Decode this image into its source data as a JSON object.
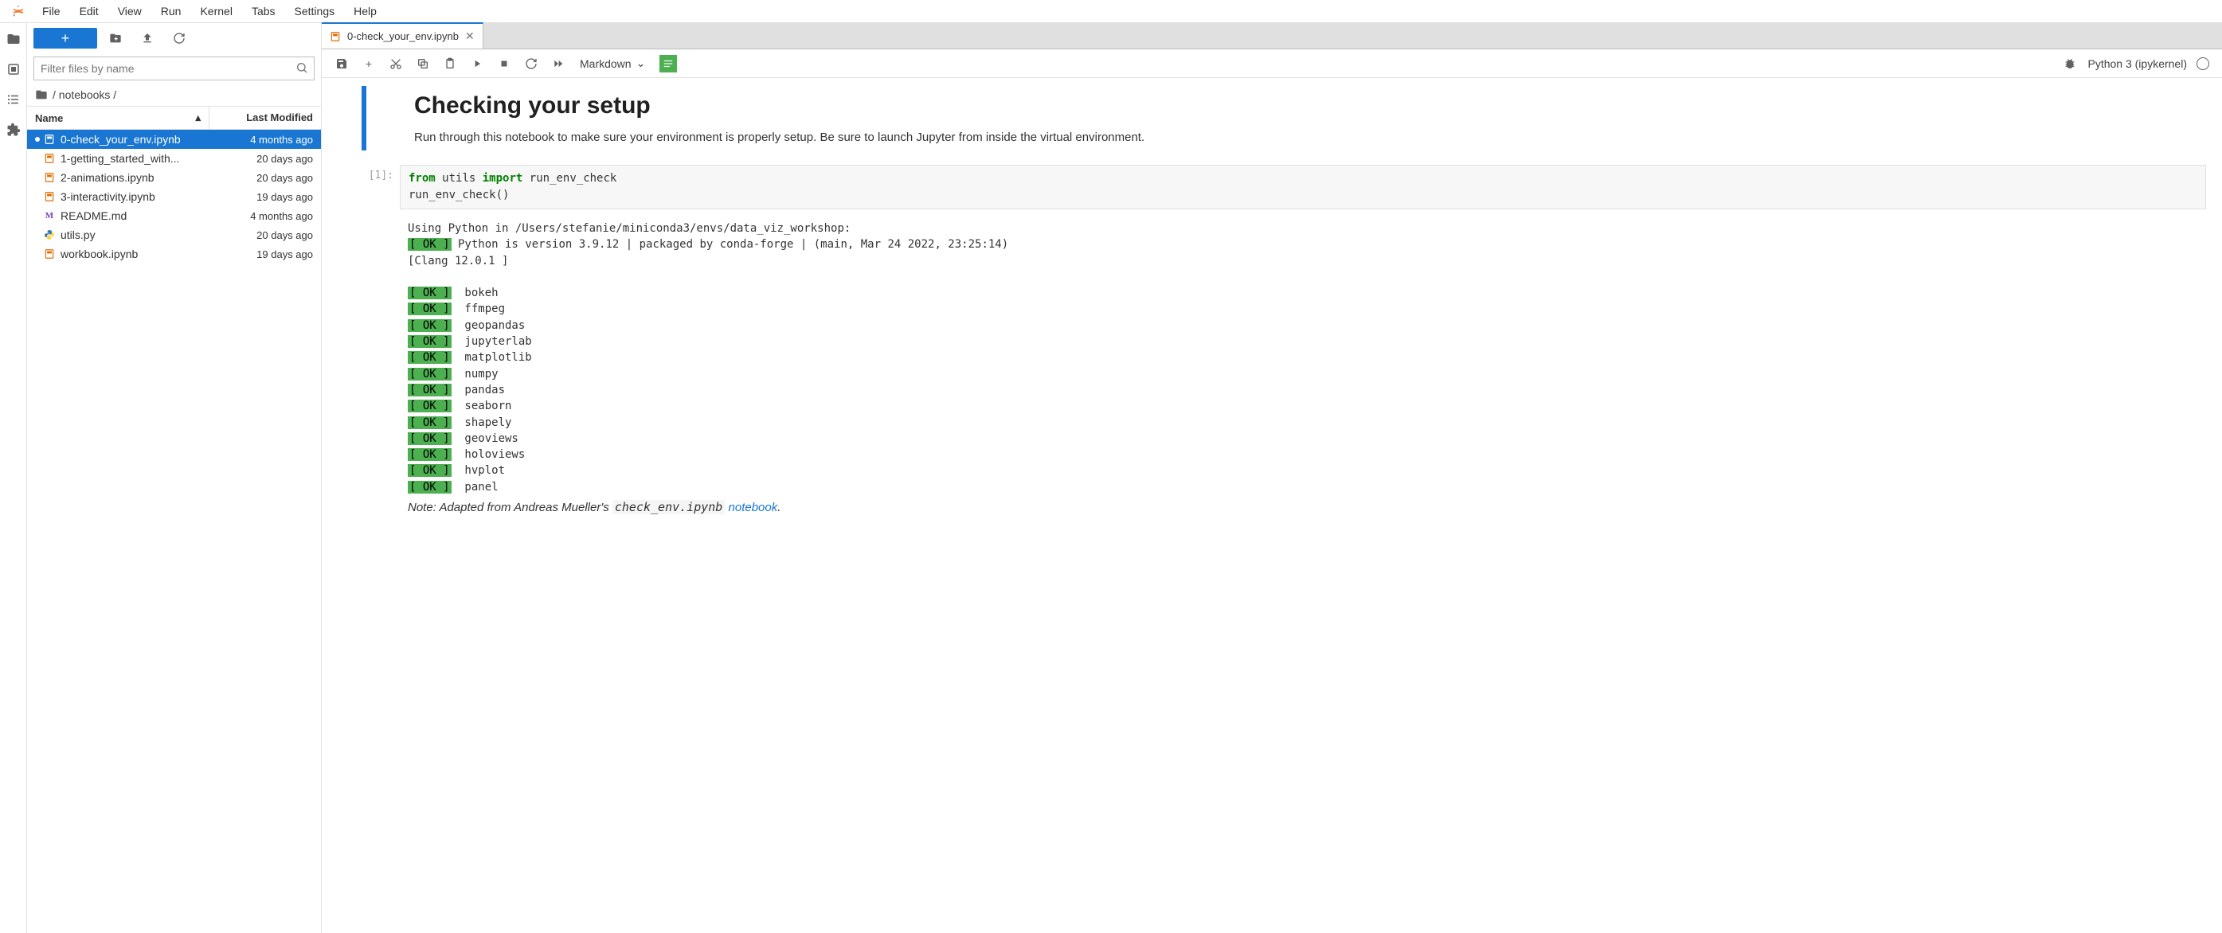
{
  "menu": [
    "File",
    "Edit",
    "View",
    "Run",
    "Kernel",
    "Tabs",
    "Settings",
    "Help"
  ],
  "filter_placeholder": "Filter files by name",
  "breadcrumb": "/ notebooks /",
  "columns": {
    "name": "Name",
    "modified": "Last Modified"
  },
  "files": [
    {
      "name": "0-check_your_env.ipynb",
      "modified": "4 months ago",
      "type": "nb",
      "selected": true
    },
    {
      "name": "1-getting_started_with...",
      "modified": "20 days ago",
      "type": "nb"
    },
    {
      "name": "2-animations.ipynb",
      "modified": "20 days ago",
      "type": "nb"
    },
    {
      "name": "3-interactivity.ipynb",
      "modified": "19 days ago",
      "type": "nb"
    },
    {
      "name": "README.md",
      "modified": "4 months ago",
      "type": "md"
    },
    {
      "name": "utils.py",
      "modified": "20 days ago",
      "type": "py"
    },
    {
      "name": "workbook.ipynb",
      "modified": "19 days ago",
      "type": "nb"
    }
  ],
  "tab": {
    "title": "0-check_your_env.ipynb"
  },
  "cell_type": "Markdown",
  "kernel": "Python 3 (ipykernel)",
  "markdown": {
    "heading": "Checking your setup",
    "paragraph": "Run through this notebook to make sure your environment is properly setup. Be sure to launch Jupyter from inside the virtual environment."
  },
  "code": {
    "prompt": "[1]:",
    "kw_from": "from",
    "module": "utils",
    "kw_import": "import",
    "imported": "run_env_check",
    "call": "run_env_check()"
  },
  "output": {
    "line1": "Using Python in /Users/stefanie/miniconda3/envs/data_viz_workshop:",
    "ok": "[ OK ]",
    "python_line": " Python is version 3.9.12 | packaged by conda-forge | (main, Mar 24 2022, 23:25:14)",
    "clang": "[Clang 12.0.1 ]",
    "packages": [
      "bokeh",
      "ffmpeg",
      "geopandas",
      "jupyterlab",
      "matplotlib",
      "numpy",
      "pandas",
      "seaborn",
      "shapely",
      "geoviews",
      "holoviews",
      "hvplot",
      "panel"
    ]
  },
  "note": {
    "prefix": "Note: Adapted from Andreas Mueller's ",
    "code": "check_env.ipynb",
    "link_text": "notebook",
    "suffix": "."
  }
}
